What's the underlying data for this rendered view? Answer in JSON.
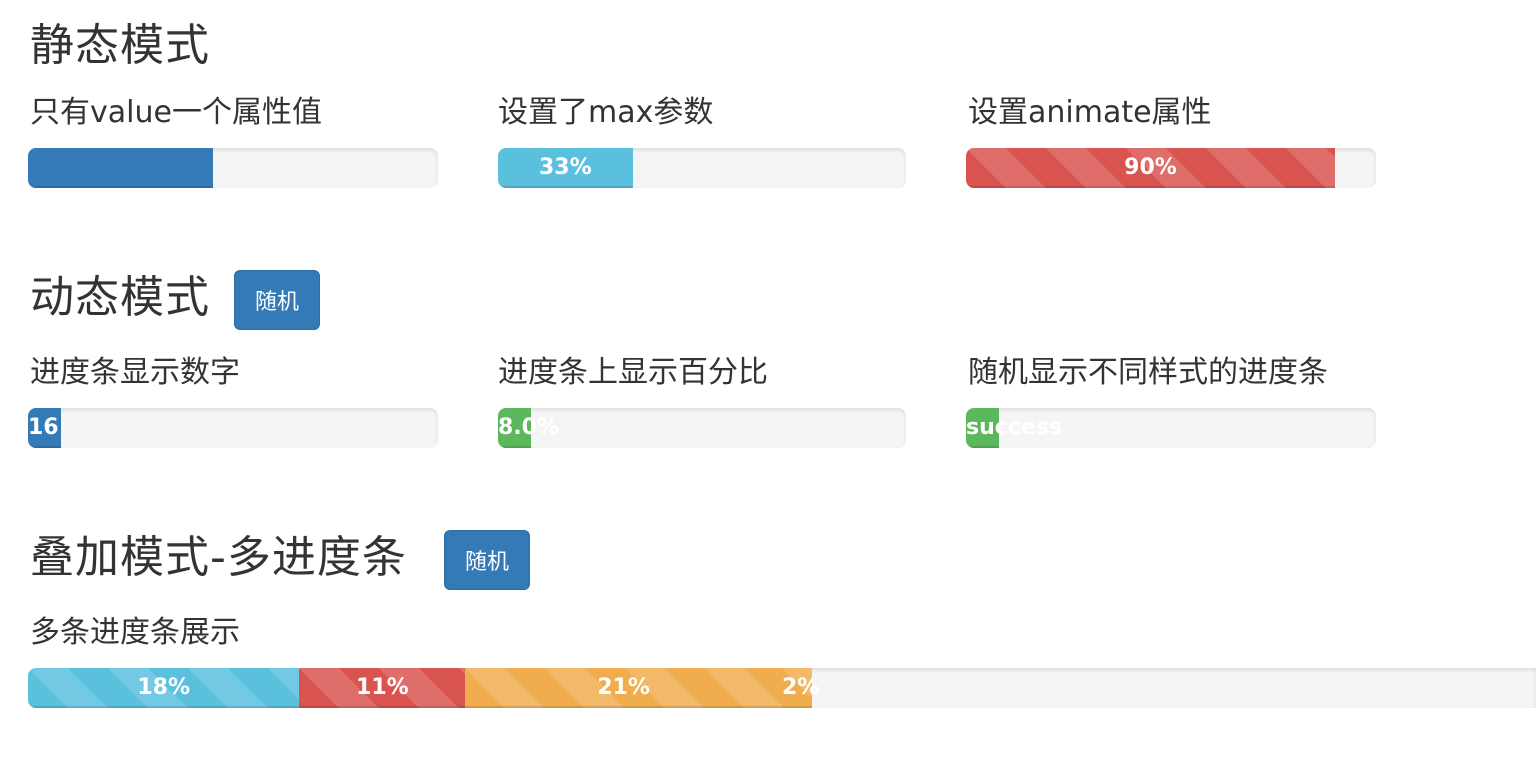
{
  "static_mode": {
    "title": "静态模式",
    "bar1": {
      "label": "只有value一个属性值",
      "text": "",
      "value": 45
    },
    "bar2": {
      "label": "设置了max参数",
      "text": "33%",
      "value": 33
    },
    "bar3": {
      "label": "设置animate属性",
      "text": "90%",
      "value": 90
    }
  },
  "dynamic_mode": {
    "title": "动态模式",
    "random_button": "随机",
    "bar1": {
      "label": "进度条显示数字",
      "text": "16",
      "value": 8
    },
    "bar2": {
      "label": "进度条上显示百分比",
      "text": "8.0%",
      "value": 8
    },
    "bar3": {
      "label": "随机显示不同样式的进度条",
      "text": "success",
      "value": 8
    }
  },
  "stacked_mode": {
    "title": "叠加模式-多进度条",
    "random_button": "随机",
    "label": "多条进度条展示",
    "segments": [
      {
        "text": "18%",
        "value": 18,
        "color": "info"
      },
      {
        "text": "11%",
        "value": 11,
        "color": "danger"
      },
      {
        "text": "21%",
        "value": 21,
        "color": "warning"
      },
      {
        "text": "2%",
        "value": 2,
        "color": "warning"
      }
    ]
  },
  "colors": {
    "primary": "#337ab7",
    "info": "#5bc0de",
    "danger": "#d9534f",
    "success": "#5cb85c",
    "warning": "#f0ad4e",
    "track": "#f5f5f5"
  }
}
